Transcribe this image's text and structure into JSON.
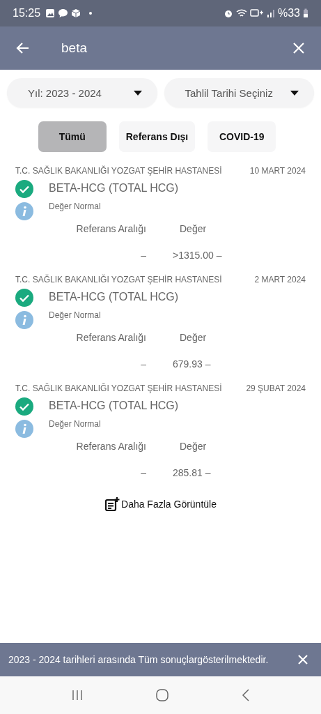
{
  "status_bar": {
    "time": "15:25",
    "battery": "%33"
  },
  "search": {
    "value": "beta"
  },
  "filters": [
    {
      "label": "Yıl: 2023 - 2024"
    },
    {
      "label": "Tahlil Tarihi Seçiniz"
    }
  ],
  "tabs": [
    {
      "label": "Tümü",
      "selected": true
    },
    {
      "label": "Referans Dışı",
      "selected": false
    },
    {
      "label": "COVID-19",
      "selected": false
    }
  ],
  "results": [
    {
      "hospital": "T.C. SAĞLIK BAKANLIĞI YOZGAT ŞEHİR HASTANESİ",
      "date": "10 MART 2024",
      "test": "BETA-HCG (TOTAL HCG)",
      "status": "Değer Normal",
      "range_label": "Referans Aralığı",
      "value_label": "Değer",
      "range": "–",
      "value": ">1315.00 –"
    },
    {
      "hospital": "T.C. SAĞLIK BAKANLIĞI YOZGAT ŞEHİR HASTANESİ",
      "date": "2 MART 2024",
      "test": "BETA-HCG (TOTAL HCG)",
      "status": "Değer Normal",
      "range_label": "Referans Aralığı",
      "value_label": "Değer",
      "range": "–",
      "value": "679.93 –"
    },
    {
      "hospital": "T.C. SAĞLIK BAKANLIĞI YOZGAT ŞEHİR HASTANESİ",
      "date": "29 ŞUBAT 2024",
      "test": "BETA-HCG (TOTAL HCG)",
      "status": "Değer Normal",
      "range_label": "Referans Aralığı",
      "value_label": "Değer",
      "range": "–",
      "value": "285.81 –"
    }
  ],
  "load_more": "Daha Fazla Görüntüle",
  "snackbar": {
    "message": "2023 - 2024 tarihleri arasında Tüm sonuçlargösterilmektedir."
  }
}
